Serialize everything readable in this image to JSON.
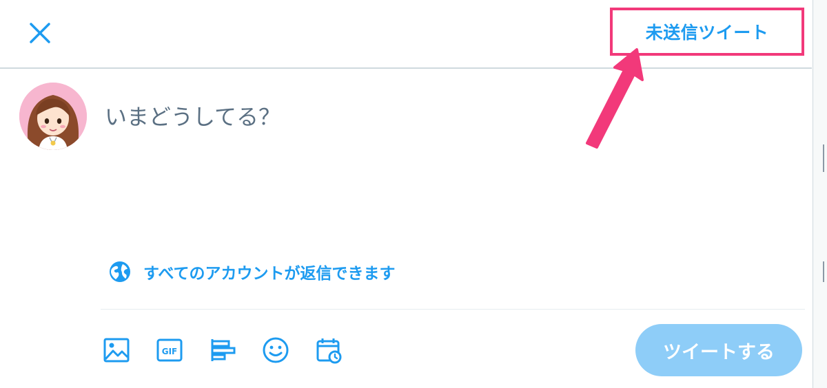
{
  "header": {
    "close_icon": "close-icon",
    "drafts_label": "未送信ツイート"
  },
  "composer": {
    "placeholder": "いまどうしてる？",
    "value": ""
  },
  "reply_setting": {
    "icon": "globe-icon",
    "label": "すべてのアカウントが返信できます"
  },
  "toolbar": {
    "tools": [
      "image-icon",
      "gif-icon",
      "poll-icon",
      "emoji-icon",
      "schedule-icon"
    ],
    "gif_text": "GIF"
  },
  "tweet_button": {
    "label": "ツイートする",
    "enabled": false
  },
  "colors": {
    "accent": "#1d9bf0",
    "highlight": "#f2397a",
    "tweet_disabled": "#8ecdf8"
  }
}
